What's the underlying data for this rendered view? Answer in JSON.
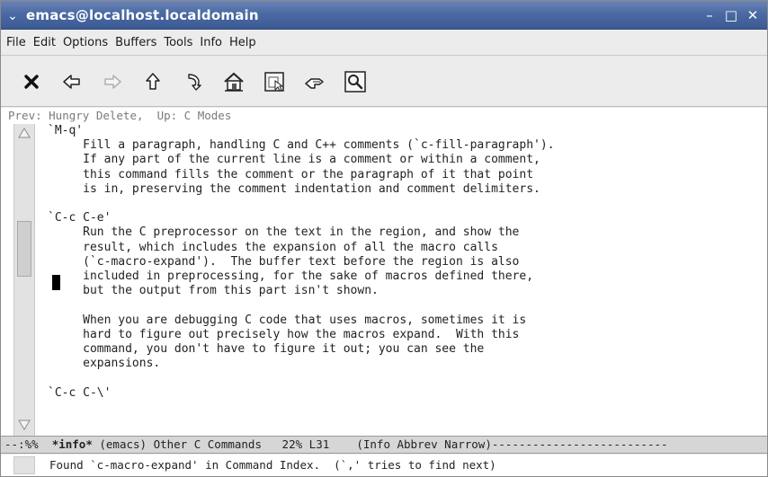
{
  "window": {
    "title": "emacs@localhost.localdomain",
    "controls": {
      "minimize": "–",
      "maximize": "□",
      "close": "✕"
    },
    "menu_glyph": "⌄"
  },
  "menubar": {
    "items": [
      "File",
      "Edit",
      "Options",
      "Buffers",
      "Tools",
      "Info",
      "Help"
    ]
  },
  "toolbar": {
    "icons": [
      "close-icon",
      "back-arrow-icon",
      "forward-arrow-icon",
      "up-arrow-icon",
      "history-back-icon",
      "home-icon",
      "goto-node-icon",
      "index-icon",
      "search-icon"
    ]
  },
  "info": {
    "header": "Prev: Hungry Delete,  Up: C Modes",
    "lines": [
      "`M-q'",
      "     Fill a paragraph, handling C and C++ comments (`c-fill-paragraph').",
      "     If any part of the current line is a comment or within a comment,",
      "     this command fills the comment or the paragraph of it that point",
      "     is in, preserving the comment indentation and comment delimiters.",
      "",
      "`C-c C-e'",
      "     Run the C preprocessor on the text in the region, and show the",
      "     result, which includes the expansion of all the macro calls",
      "     (`c-macro-expand').  The buffer text before the region is also",
      "     included in preprocessing, for the sake of macros defined there,",
      "     but the output from this part isn't shown.",
      "",
      "     When you are debugging C code that uses macros, sometimes it is",
      "     hard to figure out precisely how the macros expand.  With this",
      "     command, you don't have to figure it out; you can see the",
      "     expansions.",
      "",
      "`C-c C-\\'"
    ]
  },
  "modeline": {
    "prefix": "--:%%  ",
    "buffer": "*info*",
    "rest": " (emacs) Other C Commands   22% L31    (Info Abbrev Narrow)--------------------------"
  },
  "echo": {
    "message": "Found `c-macro-expand' in Command Index.  (`,' tries to find next)"
  }
}
